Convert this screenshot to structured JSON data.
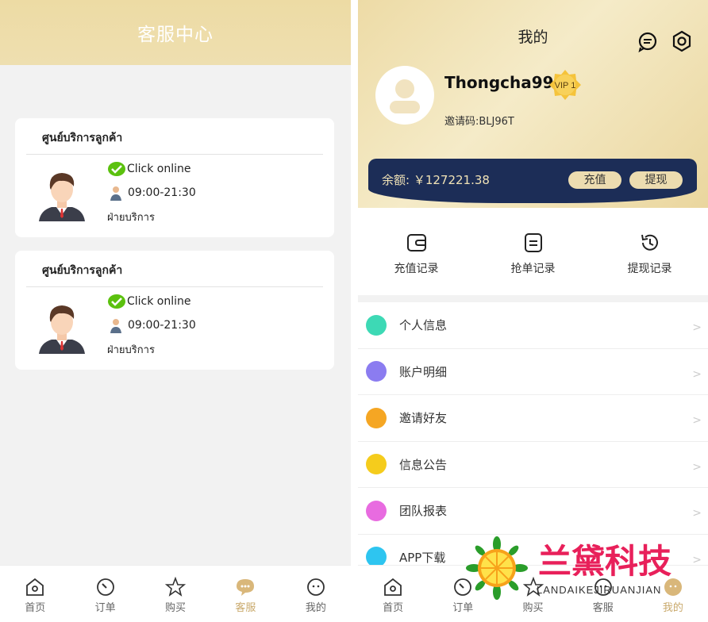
{
  "left": {
    "title": "客服中心",
    "cards": [
      {
        "title": "ศูนย์บริการลูกค้า",
        "status": "Click online",
        "hours": "09:00-21:30",
        "dept": "ฝ่ายบริการ"
      },
      {
        "title": "ศูนย์บริการลูกค้า",
        "status": "Click online",
        "hours": "09:00-21:30",
        "dept": "ฝ่ายบริการ"
      }
    ],
    "tabbar": [
      {
        "label": "首页",
        "icon": "home-icon"
      },
      {
        "label": "订单",
        "icon": "gauge-icon"
      },
      {
        "label": "购买",
        "icon": "star-icon"
      },
      {
        "label": "客服",
        "icon": "chat-bubble-icon",
        "active": true
      },
      {
        "label": "我的",
        "icon": "face-icon"
      }
    ]
  },
  "right": {
    "title": "我的",
    "icons": [
      "message-icon",
      "settings-icon"
    ],
    "username": "Thongcha99",
    "vip": "VIP 1",
    "invite_code": "邀请码:BLJ96T",
    "balance_label": "余额:  ￥127221.38",
    "recharge_button": "充值",
    "withdraw_button": "提现",
    "quick_actions": [
      {
        "label": "充值记录",
        "icon": "wallet-icon"
      },
      {
        "label": "抢单记录",
        "icon": "document-icon"
      },
      {
        "label": "提现记录",
        "icon": "history-icon"
      }
    ],
    "menu": [
      {
        "label": "个人信息",
        "icon": "user-icon",
        "color": "#3dd9b5"
      },
      {
        "label": "账户明细",
        "icon": "ledger-icon",
        "color": "#8b7cf0"
      },
      {
        "label": "邀请好友",
        "icon": "star-badge-icon",
        "color": "#f5a623"
      },
      {
        "label": "信息公告",
        "icon": "chat-icon",
        "color": "#f5cc1c"
      },
      {
        "label": "团队报表",
        "icon": "team-icon",
        "color": "#e86be0"
      },
      {
        "label": "APP下载",
        "icon": "download-icon",
        "color": "#2ec5f0"
      }
    ],
    "tabbar": [
      {
        "label": "首页",
        "icon": "home-icon"
      },
      {
        "label": "订单",
        "icon": "gauge-icon"
      },
      {
        "label": "购买",
        "icon": "star-icon"
      },
      {
        "label": "客服",
        "icon": "chat-bubble-icon"
      },
      {
        "label": "我的",
        "icon": "face-icon",
        "active": true
      }
    ]
  },
  "watermark": {
    "brand": "兰黛科技",
    "sub": "LANDAIKEJIRUANJIAN"
  },
  "colors": {
    "gold": "#eddba4",
    "navy": "#1c2d57",
    "active": "#c9a96b"
  }
}
